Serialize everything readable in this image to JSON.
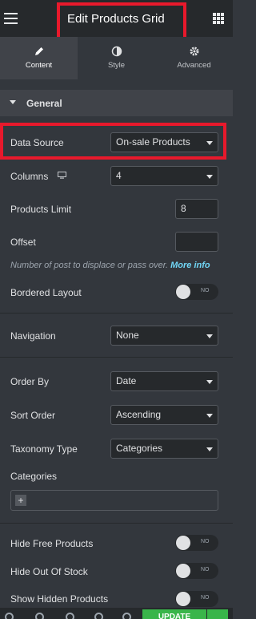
{
  "header": {
    "title": "Edit Products Grid"
  },
  "tabs": [
    {
      "label": "Content",
      "icon": "pencil-icon"
    },
    {
      "label": "Style",
      "icon": "half-circle-icon"
    },
    {
      "label": "Advanced",
      "icon": "gear-icon"
    }
  ],
  "section": {
    "title": "General"
  },
  "fields": {
    "data_source": {
      "label": "Data Source",
      "value": "On-sale Products"
    },
    "columns": {
      "label": "Columns",
      "value": "4"
    },
    "products_limit": {
      "label": "Products Limit",
      "value": "8"
    },
    "offset": {
      "label": "Offset",
      "value": ""
    },
    "offset_description": "Number of post to displace or pass over.",
    "more_info": "More info",
    "bordered_layout": {
      "label": "Bordered Layout",
      "toggle": "NO"
    },
    "navigation": {
      "label": "Navigation",
      "value": "None"
    },
    "order_by": {
      "label": "Order By",
      "value": "Date"
    },
    "sort_order": {
      "label": "Sort Order",
      "value": "Ascending"
    },
    "taxonomy_type": {
      "label": "Taxonomy Type",
      "value": "Categories"
    },
    "categories": {
      "label": "Categories"
    },
    "hide_free": {
      "label": "Hide Free Products",
      "toggle": "NO"
    },
    "hide_out_of_stock": {
      "label": "Hide Out Of Stock",
      "toggle": "NO"
    },
    "show_hidden": {
      "label": "Show Hidden Products",
      "toggle": "NO"
    }
  },
  "footer": {
    "update_label": "UPDATE"
  },
  "colors": {
    "accent": "#71d7f7",
    "highlight": "#e8192c",
    "update": "#39b54a"
  }
}
